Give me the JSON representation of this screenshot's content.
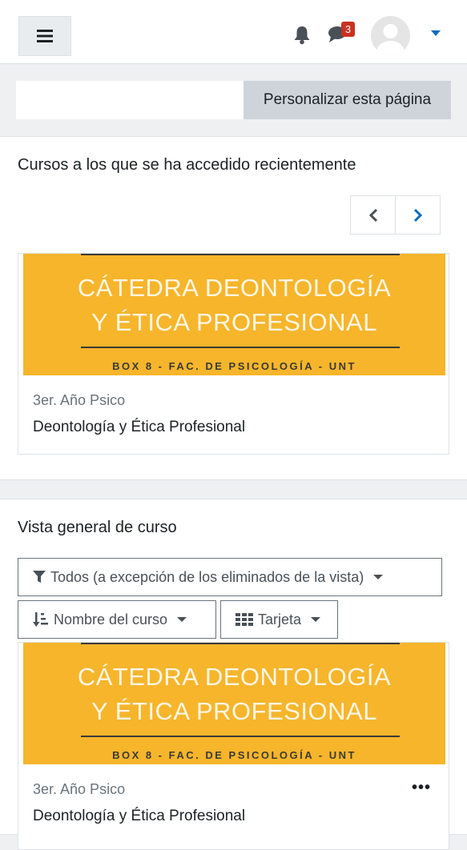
{
  "header": {
    "notification_count": "3",
    "icons": {
      "menu": "hamburger-icon",
      "notifications": "bell-icon",
      "messages": "chat-bubble-icon",
      "user": "avatar",
      "dropdown": "caret-down-icon"
    },
    "accent": "#0f6cbf",
    "badge_color": "#ca3120"
  },
  "customize": {
    "button_label": "Personalizar esta página"
  },
  "recent": {
    "title": "Cursos a los que se ha accedido recientemente",
    "pager": {
      "prev": "chevron-left-icon",
      "next": "chevron-right-icon"
    },
    "course": {
      "image_line1": "CÁTEDRA DEONTOLOGÍA",
      "image_line2": "Y ÉTICA PROFESIONAL",
      "image_line3": "BOX 8 - FAC. DE PSICOLOGÍA - UNT",
      "category": "3er. Año Psico",
      "name": "Deontología y Ética Profesional"
    }
  },
  "overview": {
    "title": "Vista general de curso",
    "filter_label": "Todos (a excepción de los eliminados de la vista)",
    "sort_label": "Nombre del curso",
    "view_label": "Tarjeta",
    "course": {
      "image_line1": "CÁTEDRA DEONTOLOGÍA",
      "image_line2": "Y ÉTICA PROFESIONAL",
      "image_line3": "BOX 8 - FAC. DE PSICOLOGÍA - UNT",
      "category": "3er. Año Psico",
      "name": "Deontología y Ética Profesional",
      "menu_icon": "ellipsis-icon"
    }
  }
}
